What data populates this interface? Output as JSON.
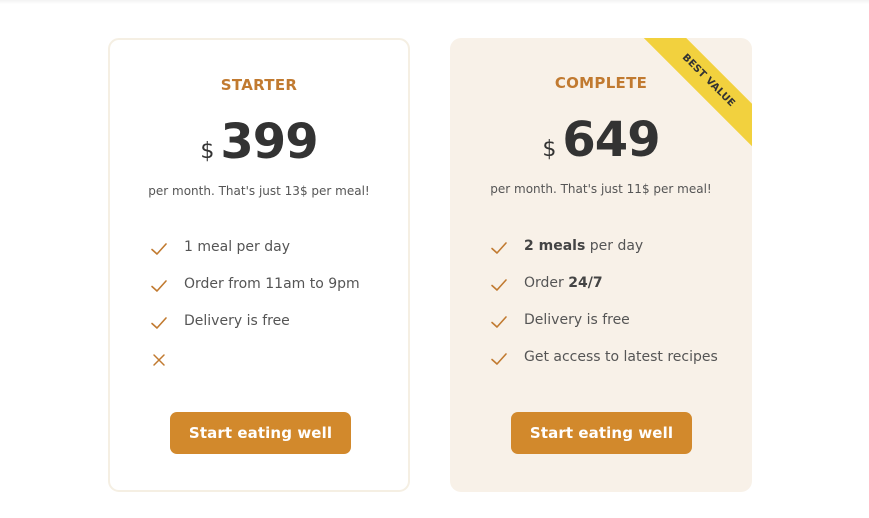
{
  "plans": [
    {
      "name": "STARTER",
      "currency": "$",
      "price": "399",
      "per_month": "per month. That's just 13$ per meal!",
      "features": [
        {
          "icon": "check-icon",
          "pre": "",
          "bold": "",
          "post": "1 meal per day"
        },
        {
          "icon": "check-icon",
          "pre": "",
          "bold": "",
          "post": "Order from 11am to 9pm"
        },
        {
          "icon": "check-icon",
          "pre": "",
          "bold": "",
          "post": "Delivery is free"
        },
        {
          "icon": "cross-icon",
          "pre": "",
          "bold": "",
          "post": ""
        }
      ],
      "cta": "Start eating well"
    },
    {
      "name": "COMPLETE",
      "currency": "$",
      "price": "649",
      "per_month": "per month. That's just 11$ per meal!",
      "ribbon": "BEST VALUE",
      "features": [
        {
          "icon": "check-icon",
          "pre": "",
          "bold": "2 meals",
          "post": " per day"
        },
        {
          "icon": "check-icon",
          "pre": "Order ",
          "bold": "24/7",
          "post": ""
        },
        {
          "icon": "check-icon",
          "pre": "",
          "bold": "",
          "post": "Delivery is free"
        },
        {
          "icon": "check-icon",
          "pre": "",
          "bold": "",
          "post": "Get access to latest recipes"
        }
      ],
      "cta": "Start eating well"
    }
  ],
  "colors": {
    "accent": "#c17a30",
    "button": "#d2892c",
    "card_highlight_bg": "#f8f1e8",
    "ribbon": "#f2d13e"
  }
}
